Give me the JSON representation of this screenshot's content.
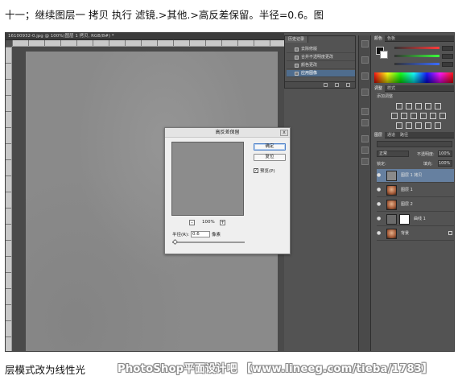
{
  "caption_top": "十一；继续图层一 拷贝 执行 滤镜.>其他.>高反差保留。半径=0.6。图",
  "caption_bottom": "层模式改为线性光",
  "watermark": "PhotoShop平面设计吧 【www.lineeg.com/tieba/1783】",
  "photoshop": {
    "document": {
      "tab_label": "16100932-0.jpg @ 100%(图层 1 拷贝, RGB/8#) *",
      "colors": {
        "canvas": "#8a8a8a",
        "workspace": "#4a4a4a"
      }
    },
    "dialog": {
      "title": "高反差保留",
      "close_symbol": "x",
      "ok_label": "确定",
      "reset_label": "复位",
      "preview_check_label": "预览(P)",
      "preview_checked": true,
      "check_mark": "✓",
      "zoom_out_symbol": "-",
      "zoom_in_symbol": "+",
      "zoom_level": "100%",
      "radius_label": "半径(R):",
      "radius_value": "0.6",
      "radius_unit": "像素"
    },
    "history": {
      "tab_label": "历史记录",
      "items": [
        {
          "label": "去除修版",
          "active": false
        },
        {
          "label": "合并不透明度更改",
          "active": false
        },
        {
          "label": "颜色更改",
          "active": false
        },
        {
          "label": "应用图像",
          "active": true
        }
      ]
    },
    "color_panel": {
      "tabs": [
        "颜色",
        "色板"
      ],
      "slider_colors": [
        "#ff3b3b",
        "#3bff3b",
        "#3b6bff"
      ]
    },
    "adjustments_panel": {
      "tabs": [
        "调整",
        "样式"
      ],
      "hint": "添加调整"
    },
    "layers_panel": {
      "tabs": [
        "图层",
        "通道",
        "路径"
      ],
      "blend_mode": "正常",
      "opacity_label": "不透明度:",
      "opacity_value": "100%",
      "fill_label": "填充:",
      "fill_value": "100%",
      "lock_label": "锁定:",
      "eye_symbol": "●",
      "layers": [
        {
          "name": "图层 1 拷贝",
          "selected": true,
          "thumb": "gray"
        },
        {
          "name": "图层 1",
          "selected": false,
          "thumb": "face"
        },
        {
          "name": "图层 2",
          "selected": false,
          "thumb": "face"
        },
        {
          "name": "曲线 1",
          "selected": false,
          "thumb": "adjust"
        },
        {
          "name": "背景",
          "selected": false,
          "thumb": "face"
        }
      ]
    }
  }
}
